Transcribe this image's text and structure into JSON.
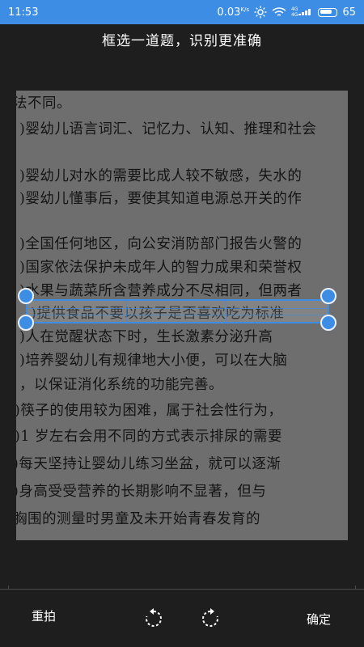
{
  "status_bar": {
    "time": "11:53",
    "network_speed": "0.03",
    "network_speed_unit": "K/s",
    "signal_top": "4G",
    "signal_bottom": "4G",
    "battery_level": "65",
    "background_color": "#3d8de4"
  },
  "header": {
    "title": "框选一道题，识别更准确"
  },
  "document_lines": [
    "法不同。",
    ")婴幼儿语言词汇、记忆力、认知、推理和社会",
    "",
    ")婴幼儿对水的需要比成人较不敏感，失水的",
    ")婴幼儿懂事后，要使其知道电源总开关的作",
    "",
    ")全国任何地区，向公安消防部门报告火警的",
    ")国家依法保护未成年人的智力成果和荣誉权",
    ")水果与蔬菜所含营养成分不尽相同，但两者",
    ")提供食品不要以孩子是否喜欢吃为标准",
    ")人在觉醒状态下时，生长激素分泌升高",
    ")培养婴幼儿有规律地大小便，可以在大脑",
    "，以保证消化系统的功能完善。",
    ")筷子的使用较为困难，属于社会性行为，",
    ")1 岁左右会用不同的方式表示排尿的需要",
    ")每天坚持让婴幼儿练习坐盆，就可以逐渐",
    ")身高受受营养的长期影响不显著，但与",
    "胸围的测量时男童及未开始青春发育的"
  ],
  "crop_selection": {
    "selected_line": ")提供食品不要以孩子是否喜欢吃为标准",
    "border_color": "#3d8de4"
  },
  "bottom_bar": {
    "retake_label": "重拍",
    "rotate_left_icon": "rotate-counterclockwise-icon",
    "rotate_right_icon": "rotate-clockwise-icon",
    "confirm_label": "确定"
  }
}
